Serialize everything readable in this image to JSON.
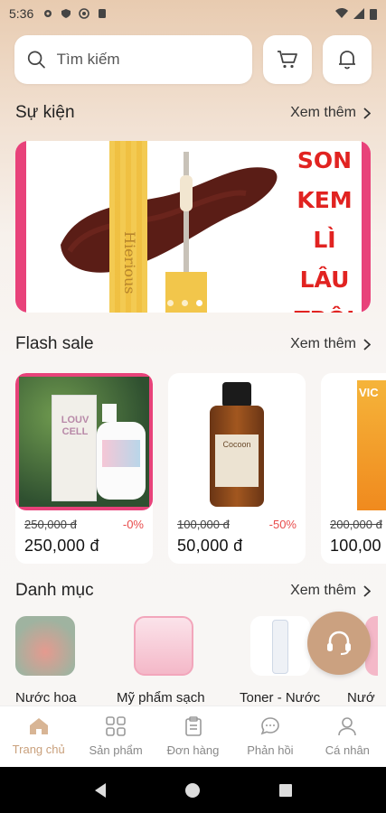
{
  "status_bar": {
    "time": "5:36"
  },
  "search": {
    "placeholder": "Tìm kiếm"
  },
  "events": {
    "title": "Sự kiện",
    "more": "Xem thêm",
    "banner": {
      "lines": [
        "SON",
        "KEM",
        "LÌ",
        "LÂU",
        "TRÔI"
      ],
      "product_brand": "Hierious"
    }
  },
  "flash_sale": {
    "title": "Flash sale",
    "more": "Xem thêm",
    "products": [
      {
        "old_price": "250,000 đ",
        "discount": "-0%",
        "price": "250,000 đ",
        "brand": "LOUV CELL"
      },
      {
        "old_price": "100,000 đ",
        "discount": "-50%",
        "price": "50,000 đ",
        "brand": "Cocoon"
      },
      {
        "old_price": "200,000 đ",
        "discount": "",
        "price": "100,00",
        "brand": "VIC"
      }
    ]
  },
  "categories": {
    "title": "Danh mục",
    "more": "Xem thêm",
    "items": [
      {
        "label": "Nước hoa"
      },
      {
        "label": "Mỹ phẩm sạch"
      },
      {
        "label": "Toner - Nước"
      },
      {
        "label": "Nướ"
      }
    ]
  },
  "bottom_nav": [
    {
      "label": "Trang chủ",
      "icon": "home-icon",
      "active": true
    },
    {
      "label": "Sản phẩm",
      "icon": "grid-icon",
      "active": false
    },
    {
      "label": "Đơn hàng",
      "icon": "clipboard-icon",
      "active": false
    },
    {
      "label": "Phản hồi",
      "icon": "chat-icon",
      "active": false
    },
    {
      "label": "Cá nhân",
      "icon": "user-icon",
      "active": false
    }
  ],
  "colors": {
    "accent": "#c9a07c",
    "pink": "#e8427a",
    "sale_red": "#e84b4b",
    "banner_red": "#e12321"
  }
}
